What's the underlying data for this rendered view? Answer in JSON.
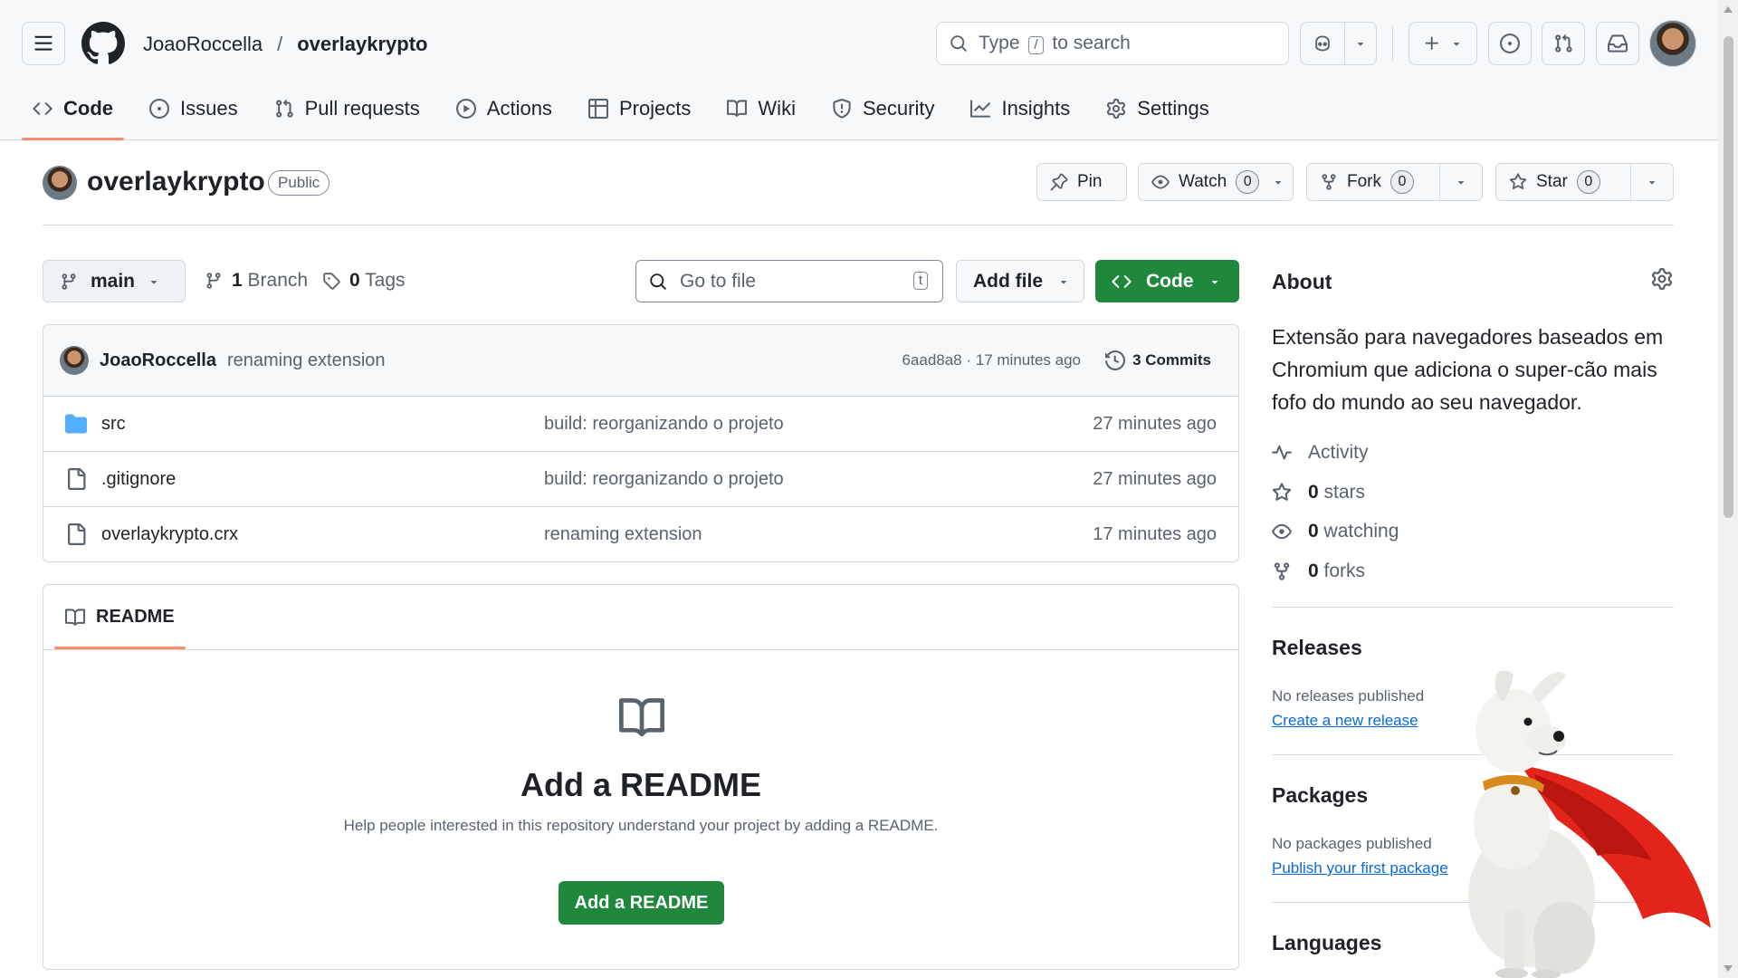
{
  "header": {
    "owner": "JoaoRoccella",
    "separator": "/",
    "repo": "overlaykrypto",
    "search": {
      "prefix": "Type",
      "key": "/",
      "suffix": "to search"
    }
  },
  "tabs": [
    {
      "label": "Code",
      "icon": "code-icon",
      "active": true
    },
    {
      "label": "Issues",
      "icon": "issue-opened-icon"
    },
    {
      "label": "Pull requests",
      "icon": "git-pull-request-icon"
    },
    {
      "label": "Actions",
      "icon": "play-icon"
    },
    {
      "label": "Projects",
      "icon": "table-icon"
    },
    {
      "label": "Wiki",
      "icon": "book-icon"
    },
    {
      "label": "Security",
      "icon": "shield-icon"
    },
    {
      "label": "Insights",
      "icon": "graph-icon"
    },
    {
      "label": "Settings",
      "icon": "gear-icon"
    }
  ],
  "repo_header": {
    "title": "overlaykrypto",
    "visibility": "Public",
    "pin_label": "Pin",
    "watch_label": "Watch",
    "watch_count": "0",
    "fork_label": "Fork",
    "fork_count": "0",
    "star_label": "Star",
    "star_count": "0"
  },
  "toolbar": {
    "branch": "main",
    "branch_count": "1",
    "branch_label": "Branch",
    "tag_count": "0",
    "tag_label": "Tags",
    "goto_placeholder": "Go to file",
    "goto_key": "t",
    "add_file_label": "Add file",
    "code_label": "Code"
  },
  "latest_commit": {
    "author": "JoaoRoccella",
    "message": "renaming extension",
    "meta": "6aad8a8 · 17 minutes ago",
    "commits_label": "3 Commits"
  },
  "files": [
    {
      "name": "src",
      "type": "folder",
      "message": "build: reorganizando o projeto",
      "age": "27 minutes ago"
    },
    {
      "name": ".gitignore",
      "type": "file",
      "message": "build: reorganizando o projeto",
      "age": "27 minutes ago"
    },
    {
      "name": "overlaykrypto.crx",
      "type": "file",
      "message": "renaming extension",
      "age": "17 minutes ago"
    }
  ],
  "readme": {
    "tab_label": "README",
    "heading": "Add a README",
    "text": "Help people interested in this repository understand your project by adding a README.",
    "button_label": "Add a README"
  },
  "sidebar": {
    "about_title": "About",
    "description": "Extensão para navegadores baseados em Chromium que adiciona o super-cão mais fofo do mundo ao seu navegador.",
    "stats": [
      {
        "icon": "pulse-icon",
        "value": "",
        "label": "Activity"
      },
      {
        "icon": "star-icon",
        "value": "0",
        "label": "stars"
      },
      {
        "icon": "eye-icon",
        "value": "0",
        "label": "watching"
      },
      {
        "icon": "repo-forked-icon",
        "value": "0",
        "label": "forks"
      }
    ],
    "releases": {
      "title": "Releases",
      "empty": "No releases published",
      "link": "Create a new release"
    },
    "packages": {
      "title": "Packages",
      "empty": "No packages published",
      "link": "Publish your first package"
    },
    "languages": {
      "title": "Languages"
    }
  },
  "colors": {
    "accent_green": "#1f883d",
    "tab_underline": "#fd8c73",
    "link_blue": "#0969da",
    "cape_red": "#e3241b"
  }
}
